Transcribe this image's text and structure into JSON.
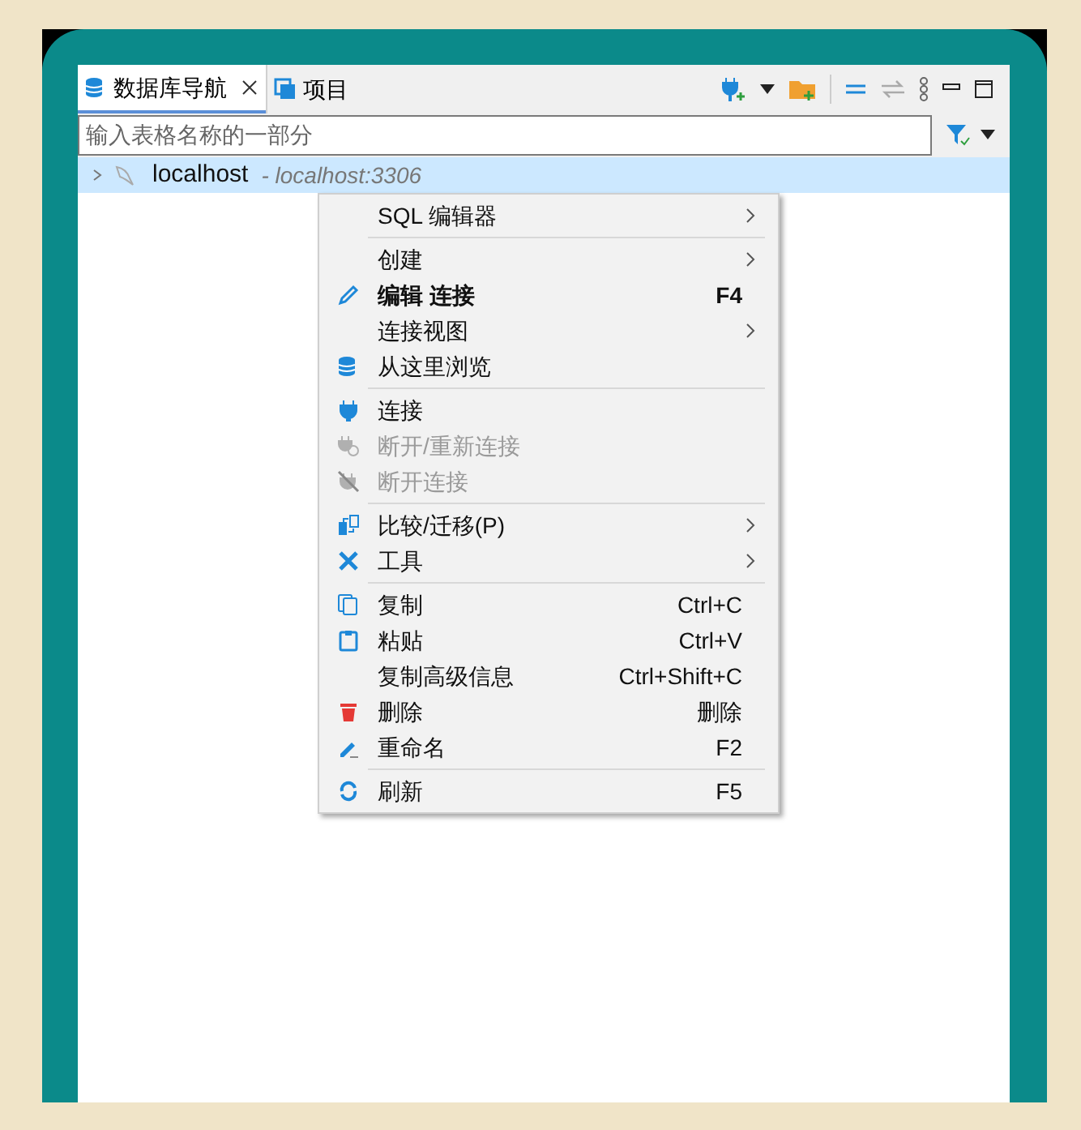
{
  "tabs": [
    {
      "label": "数据库导航",
      "selected": true,
      "closable": true
    },
    {
      "label": "项目",
      "selected": false,
      "closable": false
    }
  ],
  "filter": {
    "placeholder": "输入表格名称的一部分"
  },
  "tree": [
    {
      "name": "localhost",
      "detail": "- localhost:3306",
      "selected": true,
      "expanded": false
    }
  ],
  "context_menu": [
    {
      "kind": "item",
      "label": "SQL 编辑器",
      "submenu": true
    },
    {
      "kind": "separator"
    },
    {
      "kind": "item",
      "label": "创建",
      "submenu": true
    },
    {
      "kind": "item",
      "label": "编辑 连接",
      "shortcut": "F4",
      "bold": true
    },
    {
      "kind": "item",
      "label": "连接视图",
      "submenu": true
    },
    {
      "kind": "item",
      "label": "从这里浏览"
    },
    {
      "kind": "separator"
    },
    {
      "kind": "item",
      "label": "连接"
    },
    {
      "kind": "item",
      "label": "断开/重新连接",
      "disabled": true
    },
    {
      "kind": "item",
      "label": "断开连接",
      "disabled": true
    },
    {
      "kind": "separator"
    },
    {
      "kind": "item",
      "label": "比较/迁移(P)",
      "submenu": true
    },
    {
      "kind": "item",
      "label": "工具",
      "submenu": true
    },
    {
      "kind": "separator"
    },
    {
      "kind": "item",
      "label": "复制",
      "shortcut": "Ctrl+C"
    },
    {
      "kind": "item",
      "label": "粘贴",
      "shortcut": "Ctrl+V"
    },
    {
      "kind": "item",
      "label": "复制高级信息",
      "shortcut": "Ctrl+Shift+C"
    },
    {
      "kind": "item",
      "label": "删除",
      "shortcut": "删除"
    },
    {
      "kind": "item",
      "label": "重命名",
      "shortcut": "F2"
    },
    {
      "kind": "separator"
    },
    {
      "kind": "item",
      "label": "刷新",
      "shortcut": "F5"
    }
  ]
}
